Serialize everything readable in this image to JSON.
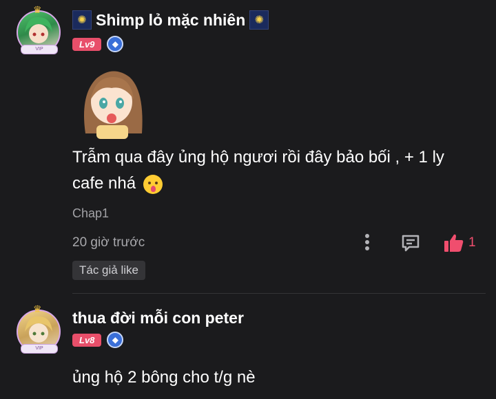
{
  "comments": [
    {
      "username": "Shimp lỏ mặc nhiên",
      "avatar_tag": "VIP",
      "level": "Lv9",
      "text_line1": "Trẫm qua đây ủng hộ ngươi rồi đây bảo bối , + 1 ly",
      "text_line2": "cafe nhá",
      "chapter": "Chap1",
      "time": "20 giờ trước",
      "like_count": "1",
      "author_like": "Tác giả like"
    },
    {
      "username": "thua đời mỗi con peter",
      "avatar_tag": "VIP",
      "level": "Lv8",
      "text_line1": "ủng hộ 2 bông cho t/g nè"
    }
  ],
  "colors": {
    "background": "#1b1b1d",
    "level_badge": "#e84f6a",
    "like": "#f04e6e",
    "muted_text": "#a8a8ac"
  },
  "icons": [
    "firework-icon",
    "shield-icon",
    "more-icon",
    "reply-icon",
    "thumbs-up-icon",
    "crown-icon",
    "emoji-icon"
  ]
}
